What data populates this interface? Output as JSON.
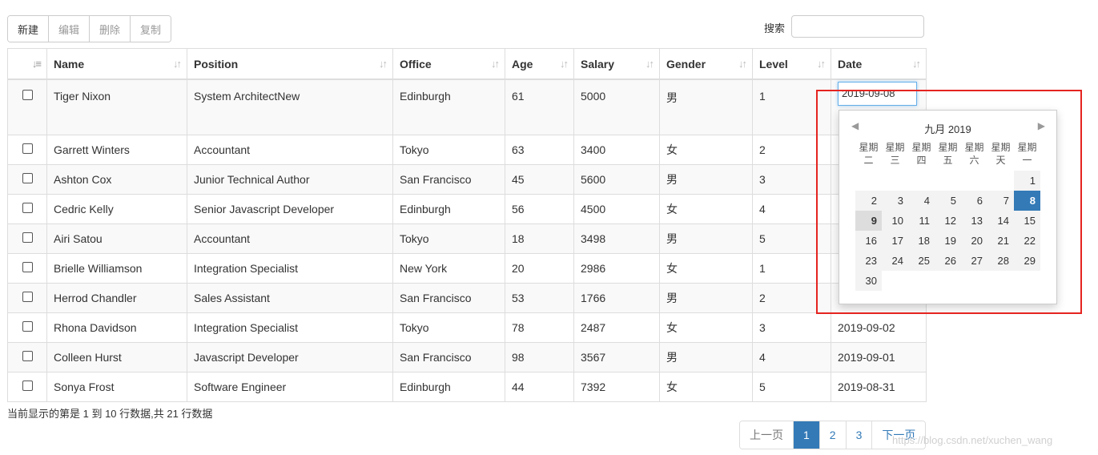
{
  "toolbar": {
    "new": "新建",
    "edit": "编辑",
    "delete": "删除",
    "copy": "复制"
  },
  "search": {
    "label": "搜索",
    "value": ""
  },
  "columns": {
    "sort": "↓≡",
    "name": "Name",
    "position": "Position",
    "office": "Office",
    "age": "Age",
    "salary": "Salary",
    "gender": "Gender",
    "level": "Level",
    "date": "Date",
    "sort_glyph": "↓↑"
  },
  "rows": [
    {
      "name": "Tiger Nixon",
      "position": "System ArchitectNew",
      "office": "Edinburgh",
      "age": "61",
      "salary": "5000",
      "gender": "男",
      "level": "1",
      "date": ""
    },
    {
      "name": "Garrett Winters",
      "position": "Accountant",
      "office": "Tokyo",
      "age": "63",
      "salary": "3400",
      "gender": "女",
      "level": "2",
      "date": ""
    },
    {
      "name": "Ashton Cox",
      "position": "Junior Technical Author",
      "office": "San Francisco",
      "age": "45",
      "salary": "5600",
      "gender": "男",
      "level": "3",
      "date": ""
    },
    {
      "name": "Cedric Kelly",
      "position": "Senior Javascript Developer",
      "office": "Edinburgh",
      "age": "56",
      "salary": "4500",
      "gender": "女",
      "level": "4",
      "date": ""
    },
    {
      "name": "Airi Satou",
      "position": "Accountant",
      "office": "Tokyo",
      "age": "18",
      "salary": "3498",
      "gender": "男",
      "level": "5",
      "date": ""
    },
    {
      "name": "Brielle Williamson",
      "position": "Integration Specialist",
      "office": "New York",
      "age": "20",
      "salary": "2986",
      "gender": "女",
      "level": "1",
      "date": ""
    },
    {
      "name": "Herrod Chandler",
      "position": "Sales Assistant",
      "office": "San Francisco",
      "age": "53",
      "salary": "1766",
      "gender": "男",
      "level": "2",
      "date": ""
    },
    {
      "name": "Rhona Davidson",
      "position": "Integration Specialist",
      "office": "Tokyo",
      "age": "78",
      "salary": "2487",
      "gender": "女",
      "level": "3",
      "date": "2019-09-02"
    },
    {
      "name": "Colleen Hurst",
      "position": "Javascript Developer",
      "office": "San Francisco",
      "age": "98",
      "salary": "3567",
      "gender": "男",
      "level": "4",
      "date": "2019-09-01"
    },
    {
      "name": "Sonya Frost",
      "position": "Software Engineer",
      "office": "Edinburgh",
      "age": "44",
      "salary": "7392",
      "gender": "女",
      "level": "5",
      "date": "2019-08-31"
    }
  ],
  "date_editor": {
    "value": "2019-09-08"
  },
  "datepicker": {
    "prev": "◀",
    "next": "▶",
    "title": "九月    2019",
    "weekdays": [
      "星期二",
      "星期三",
      "星期四",
      "星期五",
      "星期六",
      "星期天",
      "星期一"
    ],
    "weeks": [
      [
        "",
        "",
        "",
        "",
        "",
        "",
        "1"
      ],
      [
        "2",
        "3",
        "4",
        "5",
        "6",
        "7",
        "8"
      ],
      [
        "9",
        "10",
        "11",
        "12",
        "13",
        "14",
        "15"
      ],
      [
        "16",
        "17",
        "18",
        "19",
        "20",
        "21",
        "22"
      ],
      [
        "23",
        "24",
        "25",
        "26",
        "27",
        "28",
        "29"
      ],
      [
        "30",
        "",
        "",
        "",
        "",
        "",
        ""
      ]
    ],
    "selected": "8",
    "today": "9"
  },
  "info": "当前显示的第是 1 到 10 行数据,共 21 行数据",
  "pager": {
    "prev": "上一页",
    "p1": "1",
    "p2": "2",
    "p3": "3",
    "next": "下一页"
  },
  "watermark": "https://blog.csdn.net/xuchen_wang",
  "colors": {
    "accent": "#337ab7",
    "highlight_box": "#e52420"
  }
}
